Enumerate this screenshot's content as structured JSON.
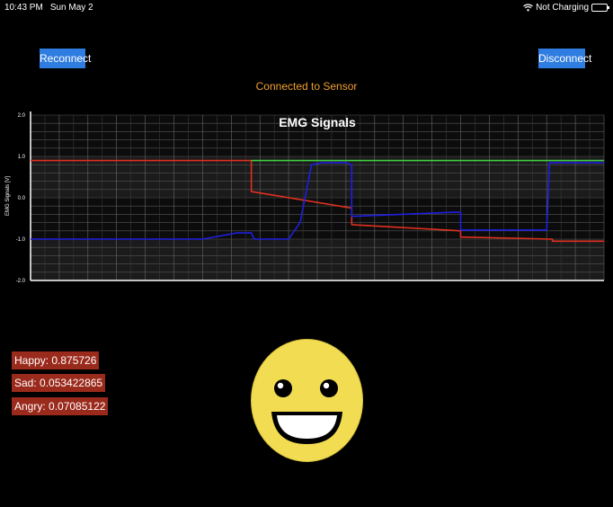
{
  "status_bar": {
    "time": "10:43 PM",
    "date": "Sun May 2",
    "charging": "Not Charging",
    "icons": [
      "wifi-icon",
      "battery-icon"
    ]
  },
  "buttons": {
    "reconnect": "Reconnect",
    "disconnect": "Disconnect"
  },
  "connection_status": "Connected to Sensor",
  "colors": {
    "button_bg": "#2f7de0",
    "status_text": "#f0a030",
    "label_bg": "#9a2a1c",
    "series_red": "#e03020",
    "series_green": "#40d040",
    "series_blue": "#1f1fe0",
    "face_fill": "#f2dd52"
  },
  "chart_data": {
    "type": "line",
    "title": "EMG Signals",
    "ylabel": "EMG Signals [V]",
    "xlabel": "",
    "ylim": [
      -2.0,
      2.0
    ],
    "xlim": [
      0,
      100
    ],
    "yticks": [
      "2.0",
      "1.0",
      "0.0",
      "-1.0",
      "-2.0"
    ],
    "grid": true,
    "series": [
      {
        "color": "#e03020",
        "x": [
          0,
          38.5,
          38.5,
          56,
          56,
          75,
          75,
          91,
          91,
          100
        ],
        "y": [
          0.9,
          0.9,
          0.15,
          -0.25,
          -0.65,
          -0.8,
          -0.95,
          -1.0,
          -1.05,
          -1.05
        ]
      },
      {
        "color": "#40d040",
        "x": [
          38.5,
          91,
          100
        ],
        "y": [
          0.9,
          0.9,
          0.9
        ]
      },
      {
        "color": "#1f1fe0",
        "x": [
          0,
          30,
          36,
          38.5,
          39,
          45,
          47,
          49,
          51,
          55,
          56,
          56,
          74,
          75,
          75,
          90,
          90.5,
          91,
          100
        ],
        "y": [
          -1.0,
          -1.0,
          -0.85,
          -0.85,
          -1.0,
          -1.0,
          -0.6,
          0.8,
          0.85,
          0.85,
          0.8,
          -0.45,
          -0.35,
          -0.35,
          -0.78,
          -0.78,
          0.85,
          0.85,
          0.85
        ]
      }
    ]
  },
  "emotions": [
    {
      "label": "Happy: 0.875726"
    },
    {
      "label": "Sad: 0.053422865"
    },
    {
      "label": "Angry: 0.07085122"
    }
  ],
  "face": {
    "expression": "happy",
    "icon": "smiley-face-icon"
  }
}
